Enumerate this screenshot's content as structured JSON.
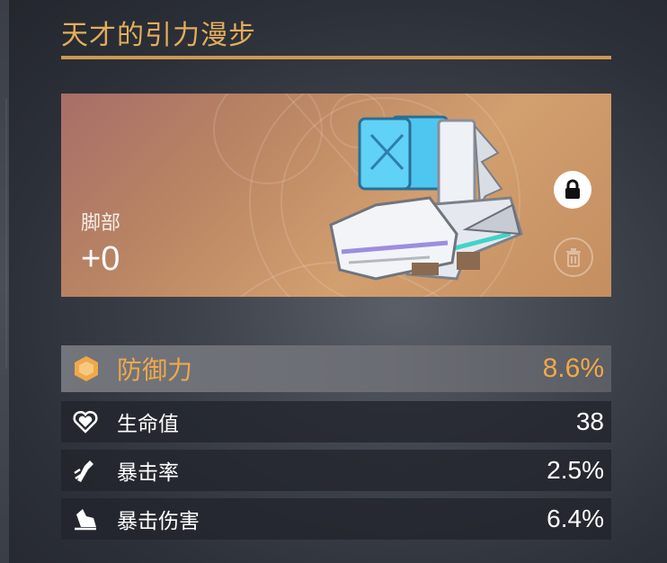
{
  "relic": {
    "name": "天才的引力漫步",
    "slot": "脚部",
    "level": "+0",
    "locked": true,
    "accent_color": "#e3ad5c"
  },
  "actions": {
    "lock_icon": "lock-icon",
    "discard_icon": "trash-icon"
  },
  "main_stat": {
    "icon": "defense-shield-icon",
    "name": "防御力",
    "value": "8.6%",
    "color": "#f0a84a"
  },
  "sub_stats": [
    {
      "icon": "heart-icon",
      "name": "生命值",
      "value": "38"
    },
    {
      "icon": "crit-rate-icon",
      "name": "暴击率",
      "value": "2.5%"
    },
    {
      "icon": "crit-damage-icon",
      "name": "暴击伤害",
      "value": "6.4%"
    }
  ]
}
